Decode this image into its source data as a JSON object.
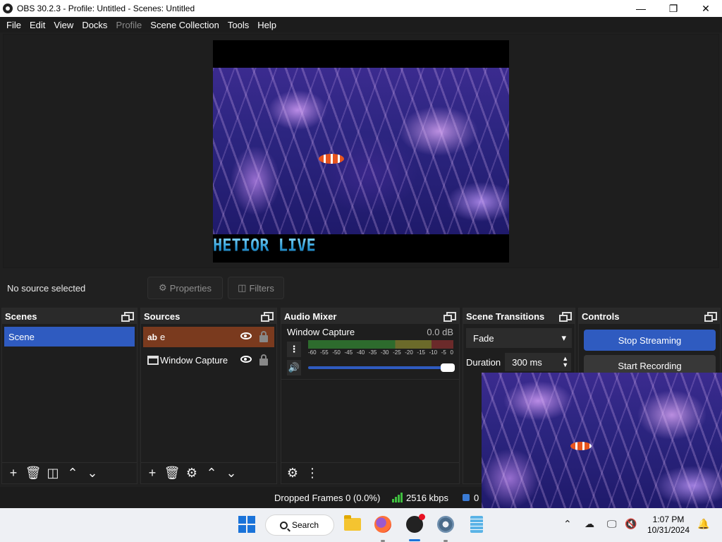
{
  "window": {
    "title": "OBS 30.2.3 - Profile: Untitled - Scenes: Untitled",
    "controls": [
      "minimize",
      "maximize",
      "close"
    ]
  },
  "menu": [
    "File",
    "Edit",
    "View",
    "Docks",
    "Profile",
    "Scene Collection",
    "Tools",
    "Help"
  ],
  "preview": {
    "overlay_text": "HETIOR LIVE"
  },
  "context": {
    "status": "No source selected",
    "properties_label": "Properties",
    "filters_label": "Filters"
  },
  "docks": {
    "scenes": {
      "title": "Scenes",
      "items": [
        "Scene"
      ]
    },
    "sources": {
      "title": "Sources",
      "items": [
        {
          "type_glyph": "ab",
          "name": "e"
        },
        {
          "type_glyph": "",
          "name": "Window Capture"
        }
      ]
    },
    "mixer": {
      "title": "Audio Mixer",
      "track": {
        "name": "Window Capture",
        "db": "0.0 dB",
        "scale": [
          "-60",
          "-55",
          "-50",
          "-45",
          "-40",
          "-35",
          "-30",
          "-25",
          "-20",
          "-15",
          "-10",
          "-5",
          "0"
        ],
        "volume_fraction": 1.0
      }
    },
    "transitions": {
      "title": "Scene Transitions",
      "selected": "Fade",
      "duration_label": "Duration",
      "duration_value": "300 ms"
    },
    "controls": {
      "title": "Controls",
      "stream_label": "Stop Streaming",
      "record_label": "Start Recording"
    }
  },
  "status": {
    "dropped": "Dropped Frames 0 (0.0%)",
    "bitrate": "2516 kbps",
    "rec_time": "0"
  },
  "taskbar": {
    "search_label": "Search",
    "time": "1:07 PM",
    "date": "10/31/2024"
  },
  "colors": {
    "accent": "#2f5bc0",
    "selected_source": "#7a3a1e",
    "signal_green": "#3fbf3f"
  }
}
